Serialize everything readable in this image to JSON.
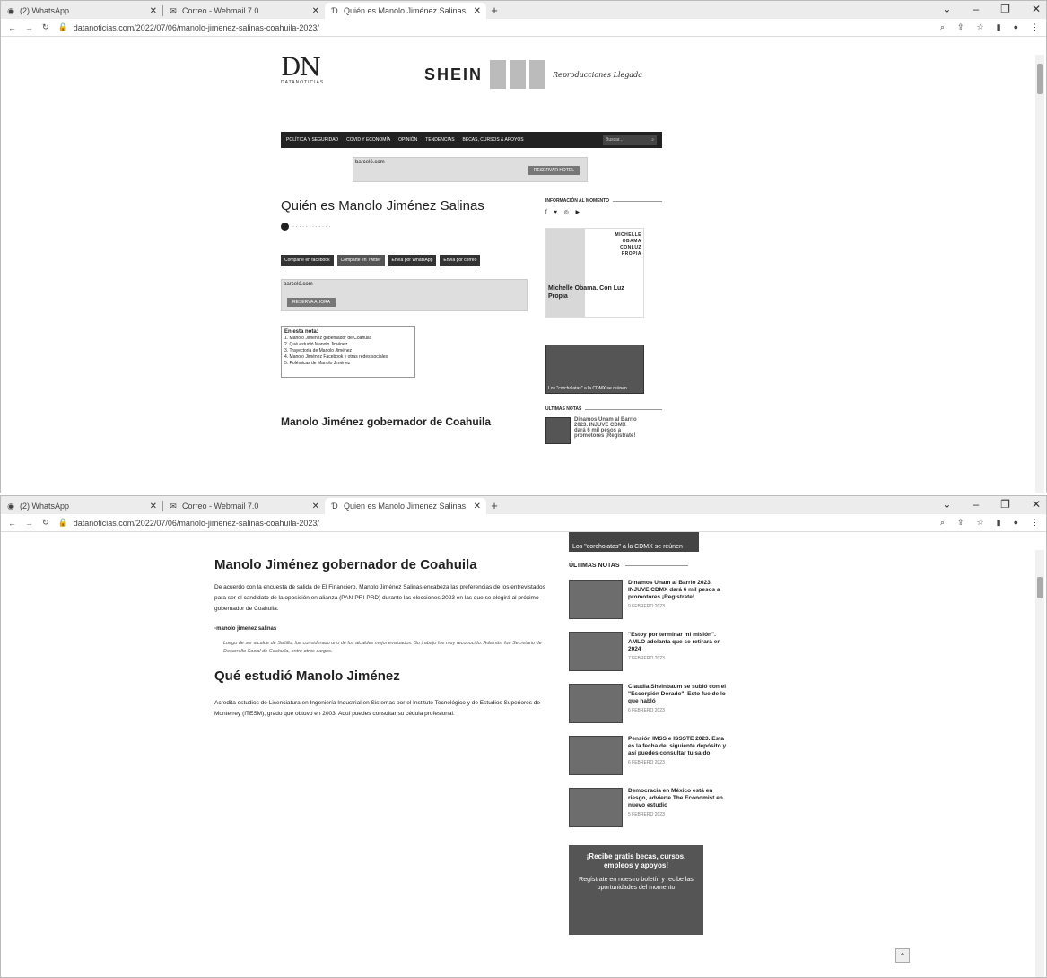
{
  "browser": {
    "tabs": [
      {
        "title": "(2) WhatsApp",
        "icon": "whatsapp-icon"
      },
      {
        "title": "Correo - Webmail 7.0",
        "icon": "mail-icon"
      },
      {
        "title": "Quién es Manolo Jiménez Salinas",
        "icon": "dn-icon"
      }
    ],
    "tabs_w2": [
      {
        "title": "(2) WhatsApp"
      },
      {
        "title": "Correo - Webmail 7.0"
      },
      {
        "title": "Quien es Manolo Jimenez Salinas"
      }
    ],
    "url": "datanoticias.com/2022/07/06/manolo-jimenez-salinas-coahuila-2023/",
    "url_w2": "datanoticias.com/2022/07/06/manolo-jimenez-salinas-coahuila-2023/"
  },
  "page1": {
    "logo_mark": "DN",
    "logo_name": "DATANOTICIAS",
    "ad_brand": "SHEIN",
    "ad_signature": "Reproducciones Llegada",
    "nav_items": [
      "POLÍTICA Y SEGURIDAD",
      "COVID Y ECONOMÍA",
      "OPINIÓN",
      "TENDENCIAS",
      "BECAS, CURSOS & APOYOS"
    ],
    "search_placeholder": "Buscar...",
    "banner_cta": "RESERVAR HOTEL",
    "banner_brand": "barceló.com",
    "banner_cta2": "RESERVA AHORA",
    "title": "Quién es Manolo Jiménez Salinas",
    "share_buttons": [
      "Comparte en facebook",
      "Comparte en Twitter",
      "Envía por WhatsApp",
      "Envía por correo"
    ],
    "toc_heading": "En esta nota:",
    "toc_items": [
      "1. Manolo Jiménez gobernador de Coahuila",
      "2. Qué estudió Manolo Jiménez",
      "3. Trayectoria de Manolo Jiménez",
      "4. Manolo Jiménez Facebook y otras redes sociales",
      "5. Polémicas de Manolo Jiménez"
    ],
    "heading": "Manolo Jiménez gobernador de Coahuila",
    "sidebar_heading": "INFORMACIÓN AL MOMENTO",
    "social_icons": "f  ♥  ◎  ▶",
    "promo_title": "MICHELLE OBAMA CONLUZ PROPIA",
    "promo_caption": "Michelle Obama. Con Luz Propia",
    "ultimas": "ÚLTIMAS NOTAS",
    "thumb_caption": "Los \"corcholatas\" a la CDMX se reúnen"
  },
  "page2": {
    "heading": "Manolo Jiménez gobernador de Coahuila",
    "paragraph": "De acuerdo con la encuesta de salida de El Financiero, Manolo Jiménez Salinas encabeza las preferencias de los entrevistados para ser el candidato de la oposición en alianza (PAN-PRI-PRD) durante las elecciones 2023 en las que se elegirá al próximo gobernador de Coahuila.",
    "image_alt": "manolo jimenez salinas",
    "caption": "Luego de ser alcalde de Saltillo, fue considerado uno de los alcaldes mejor evaluados. Su trabajo fue muy reconocido. Además, fue Secretario de Desarrollo Social de Coahuila, entre otros cargos.",
    "heading2": "Qué estudió Manolo Jiménez",
    "paragraph2": "Acredita estudios de Licenciatura en Ingeniería Industrial en Sistemas por el Instituto Tecnológico y de Estudios Superiores de Monterrey (ITESM), grado que obtuvo en 2003. Aquí puedes consultar su cédula profesional.",
    "strip_caption": "Los \"corcholatas\" a la CDMX se reúnen",
    "ultimas": "ÚLTIMAS NOTAS",
    "news": [
      {
        "title": "Dinamos Unam al Barrio 2023. INJUVE CDMX dará 6 mil pesos a promotores ¡Regístrate!",
        "date": "9 FEBRERO 2023"
      },
      {
        "title": "\"Estoy por terminar mi misión\". AMLO adelanta que se retirará en 2024",
        "date": "7 FEBRERO 2023"
      },
      {
        "title": "Claudia Sheinbaum se subió con el \"Escorpión Dorado\". Esto fue de lo que habló",
        "date": "6 FEBRERO 2023"
      },
      {
        "title": "Pensión IMSS e ISSSTE 2023. Esta es la fecha del siguiente depósito y así puedes consultar tu saldo",
        "date": "6 FEBRERO 2023"
      },
      {
        "title": "Democracia en México está en riesgo, advierte The Economist en nuevo estudio",
        "date": "5 FEBRERO 2023"
      }
    ],
    "promo_title": "¡Recibe gratis becas, cursos, empleos y apoyos!",
    "promo_body": "Regístrate en nuestro boletín y recibe las oportunidades del momento"
  }
}
